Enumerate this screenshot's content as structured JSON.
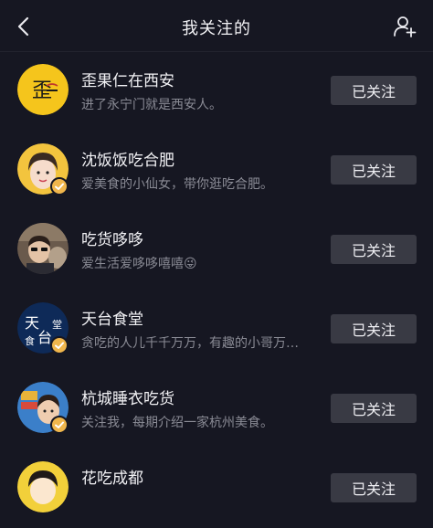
{
  "header": {
    "title": "我关注的",
    "back_icon": "chevron-left-icon",
    "add_friend_icon": "add-person-icon"
  },
  "follow_list": [
    {
      "name": "歪果仁在西安",
      "desc": "进了永宁门就是西安人。",
      "button": "已关注",
      "verified": false
    },
    {
      "name": "沈饭饭吃合肥",
      "desc": "爱美食的小仙女，带你逛吃合肥。",
      "button": "已关注",
      "verified": true
    },
    {
      "name": "吃货哆哆",
      "desc": "爱生活爱哆哆嘻嘻😜",
      "button": "已关注",
      "verified": false
    },
    {
      "name": "天台食堂",
      "desc": "贪吃的人儿千千万万，有趣的小哥万…",
      "button": "已关注",
      "verified": true
    },
    {
      "name": "杭城睡衣吃货",
      "desc": "关注我，每期介绍一家杭州美食。",
      "button": "已关注",
      "verified": true
    },
    {
      "name": "花吃成都",
      "desc": "",
      "button": "已关注",
      "verified": false
    }
  ],
  "colors": {
    "background": "#161722",
    "button": "#393a44",
    "verified_badge": "#f0b64c"
  }
}
